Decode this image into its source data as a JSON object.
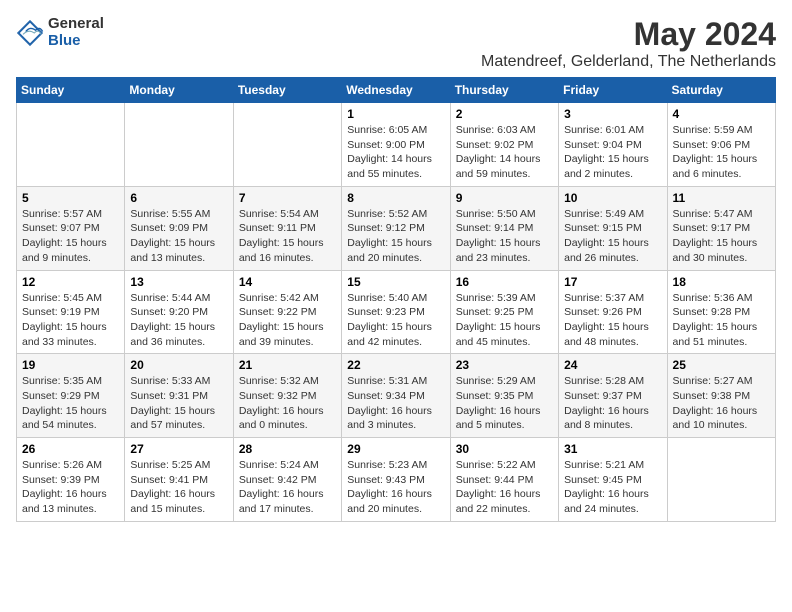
{
  "logo": {
    "general": "General",
    "blue": "Blue"
  },
  "title": {
    "month_year": "May 2024",
    "location": "Matendreef, Gelderland, The Netherlands"
  },
  "weekdays": [
    "Sunday",
    "Monday",
    "Tuesday",
    "Wednesday",
    "Thursday",
    "Friday",
    "Saturday"
  ],
  "weeks": [
    [
      {
        "day": "",
        "info": ""
      },
      {
        "day": "",
        "info": ""
      },
      {
        "day": "",
        "info": ""
      },
      {
        "day": "1",
        "info": "Sunrise: 6:05 AM\nSunset: 9:00 PM\nDaylight: 14 hours\nand 55 minutes."
      },
      {
        "day": "2",
        "info": "Sunrise: 6:03 AM\nSunset: 9:02 PM\nDaylight: 14 hours\nand 59 minutes."
      },
      {
        "day": "3",
        "info": "Sunrise: 6:01 AM\nSunset: 9:04 PM\nDaylight: 15 hours\nand 2 minutes."
      },
      {
        "day": "4",
        "info": "Sunrise: 5:59 AM\nSunset: 9:06 PM\nDaylight: 15 hours\nand 6 minutes."
      }
    ],
    [
      {
        "day": "5",
        "info": "Sunrise: 5:57 AM\nSunset: 9:07 PM\nDaylight: 15 hours\nand 9 minutes."
      },
      {
        "day": "6",
        "info": "Sunrise: 5:55 AM\nSunset: 9:09 PM\nDaylight: 15 hours\nand 13 minutes."
      },
      {
        "day": "7",
        "info": "Sunrise: 5:54 AM\nSunset: 9:11 PM\nDaylight: 15 hours\nand 16 minutes."
      },
      {
        "day": "8",
        "info": "Sunrise: 5:52 AM\nSunset: 9:12 PM\nDaylight: 15 hours\nand 20 minutes."
      },
      {
        "day": "9",
        "info": "Sunrise: 5:50 AM\nSunset: 9:14 PM\nDaylight: 15 hours\nand 23 minutes."
      },
      {
        "day": "10",
        "info": "Sunrise: 5:49 AM\nSunset: 9:15 PM\nDaylight: 15 hours\nand 26 minutes."
      },
      {
        "day": "11",
        "info": "Sunrise: 5:47 AM\nSunset: 9:17 PM\nDaylight: 15 hours\nand 30 minutes."
      }
    ],
    [
      {
        "day": "12",
        "info": "Sunrise: 5:45 AM\nSunset: 9:19 PM\nDaylight: 15 hours\nand 33 minutes."
      },
      {
        "day": "13",
        "info": "Sunrise: 5:44 AM\nSunset: 9:20 PM\nDaylight: 15 hours\nand 36 minutes."
      },
      {
        "day": "14",
        "info": "Sunrise: 5:42 AM\nSunset: 9:22 PM\nDaylight: 15 hours\nand 39 minutes."
      },
      {
        "day": "15",
        "info": "Sunrise: 5:40 AM\nSunset: 9:23 PM\nDaylight: 15 hours\nand 42 minutes."
      },
      {
        "day": "16",
        "info": "Sunrise: 5:39 AM\nSunset: 9:25 PM\nDaylight: 15 hours\nand 45 minutes."
      },
      {
        "day": "17",
        "info": "Sunrise: 5:37 AM\nSunset: 9:26 PM\nDaylight: 15 hours\nand 48 minutes."
      },
      {
        "day": "18",
        "info": "Sunrise: 5:36 AM\nSunset: 9:28 PM\nDaylight: 15 hours\nand 51 minutes."
      }
    ],
    [
      {
        "day": "19",
        "info": "Sunrise: 5:35 AM\nSunset: 9:29 PM\nDaylight: 15 hours\nand 54 minutes."
      },
      {
        "day": "20",
        "info": "Sunrise: 5:33 AM\nSunset: 9:31 PM\nDaylight: 15 hours\nand 57 minutes."
      },
      {
        "day": "21",
        "info": "Sunrise: 5:32 AM\nSunset: 9:32 PM\nDaylight: 16 hours\nand 0 minutes."
      },
      {
        "day": "22",
        "info": "Sunrise: 5:31 AM\nSunset: 9:34 PM\nDaylight: 16 hours\nand 3 minutes."
      },
      {
        "day": "23",
        "info": "Sunrise: 5:29 AM\nSunset: 9:35 PM\nDaylight: 16 hours\nand 5 minutes."
      },
      {
        "day": "24",
        "info": "Sunrise: 5:28 AM\nSunset: 9:37 PM\nDaylight: 16 hours\nand 8 minutes."
      },
      {
        "day": "25",
        "info": "Sunrise: 5:27 AM\nSunset: 9:38 PM\nDaylight: 16 hours\nand 10 minutes."
      }
    ],
    [
      {
        "day": "26",
        "info": "Sunrise: 5:26 AM\nSunset: 9:39 PM\nDaylight: 16 hours\nand 13 minutes."
      },
      {
        "day": "27",
        "info": "Sunrise: 5:25 AM\nSunset: 9:41 PM\nDaylight: 16 hours\nand 15 minutes."
      },
      {
        "day": "28",
        "info": "Sunrise: 5:24 AM\nSunset: 9:42 PM\nDaylight: 16 hours\nand 17 minutes."
      },
      {
        "day": "29",
        "info": "Sunrise: 5:23 AM\nSunset: 9:43 PM\nDaylight: 16 hours\nand 20 minutes."
      },
      {
        "day": "30",
        "info": "Sunrise: 5:22 AM\nSunset: 9:44 PM\nDaylight: 16 hours\nand 22 minutes."
      },
      {
        "day": "31",
        "info": "Sunrise: 5:21 AM\nSunset: 9:45 PM\nDaylight: 16 hours\nand 24 minutes."
      },
      {
        "day": "",
        "info": ""
      }
    ]
  ]
}
